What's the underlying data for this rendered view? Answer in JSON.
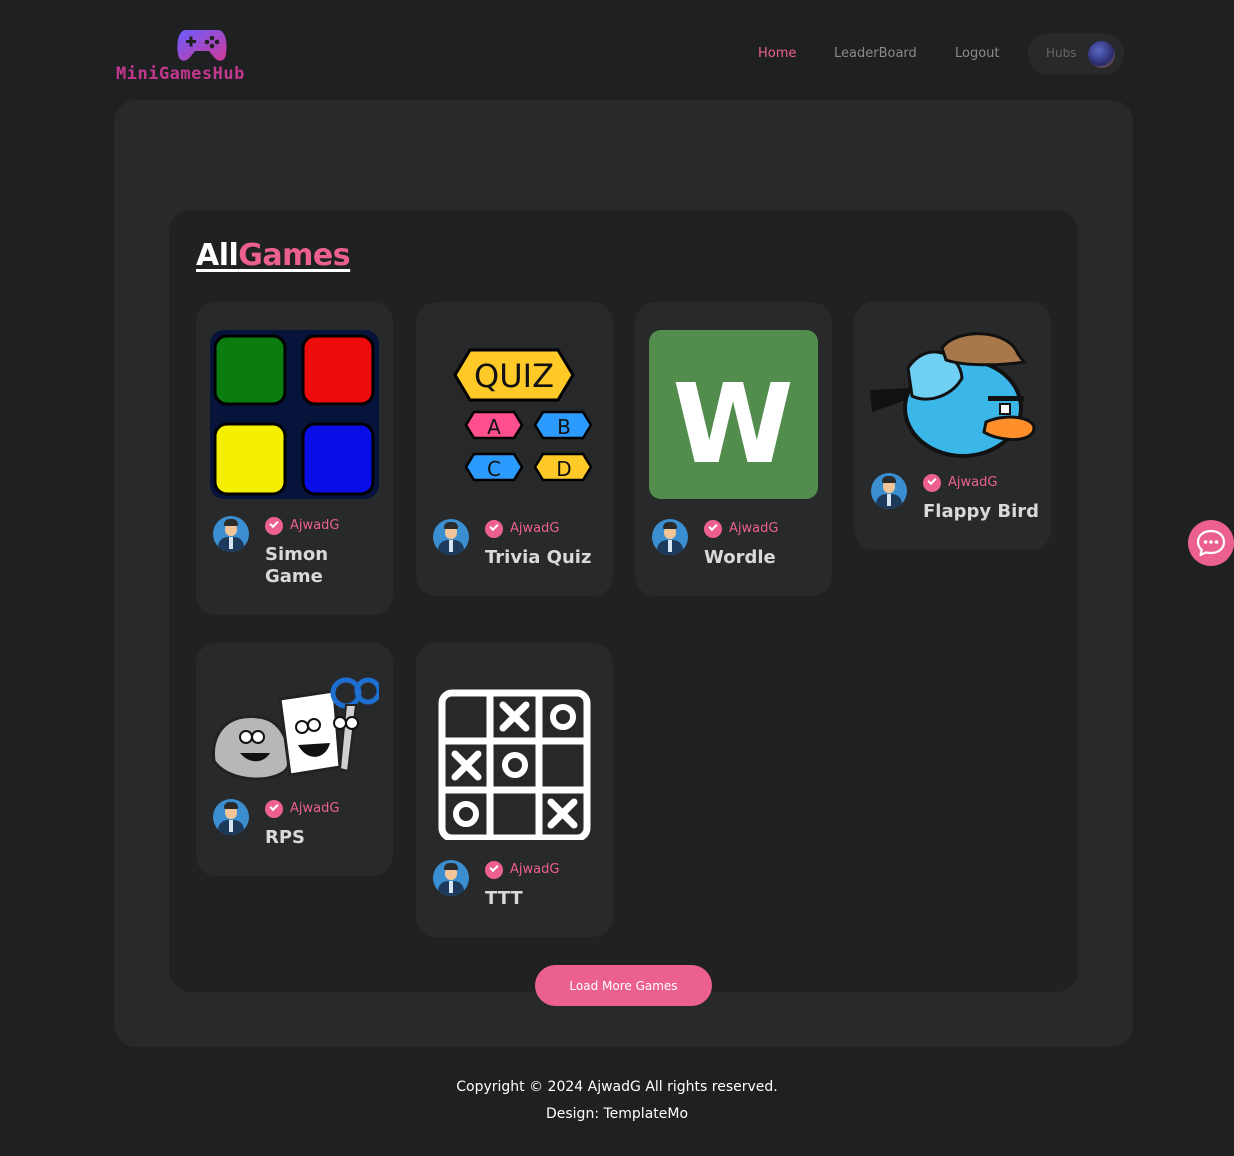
{
  "brand": {
    "name": "MiniGamesHub"
  },
  "nav": {
    "home": "Home",
    "leaderboard": "LeaderBoard",
    "logout": "Logout",
    "hubs": "Hubs"
  },
  "section": {
    "title_white": "All",
    "title_pink": "Games"
  },
  "games": [
    {
      "author": "AjwadG",
      "name": "Simon Game"
    },
    {
      "author": "AjwadG",
      "name": "Trivia Quiz"
    },
    {
      "author": "AjwadG",
      "name": "Wordle"
    },
    {
      "author": "AjwadG",
      "name": "Flappy Bird"
    },
    {
      "author": "AjwadG",
      "name": "RPS"
    },
    {
      "author": "AjwadG",
      "name": "TTT"
    }
  ],
  "thumbs": {
    "quiz": {
      "title": "QUIZ",
      "a": "A",
      "b": "B",
      "c": "C",
      "d": "D"
    },
    "wordle": {
      "letter": "W"
    }
  },
  "load_more": "Load More Games",
  "footer": {
    "copyright": "Copyright © 2024 AjwadG All rights reserved.",
    "design": "Design: TemplateMo"
  },
  "colors": {
    "accent": "#ec6090",
    "bg": "#1f2022",
    "panel": "#27292a"
  }
}
